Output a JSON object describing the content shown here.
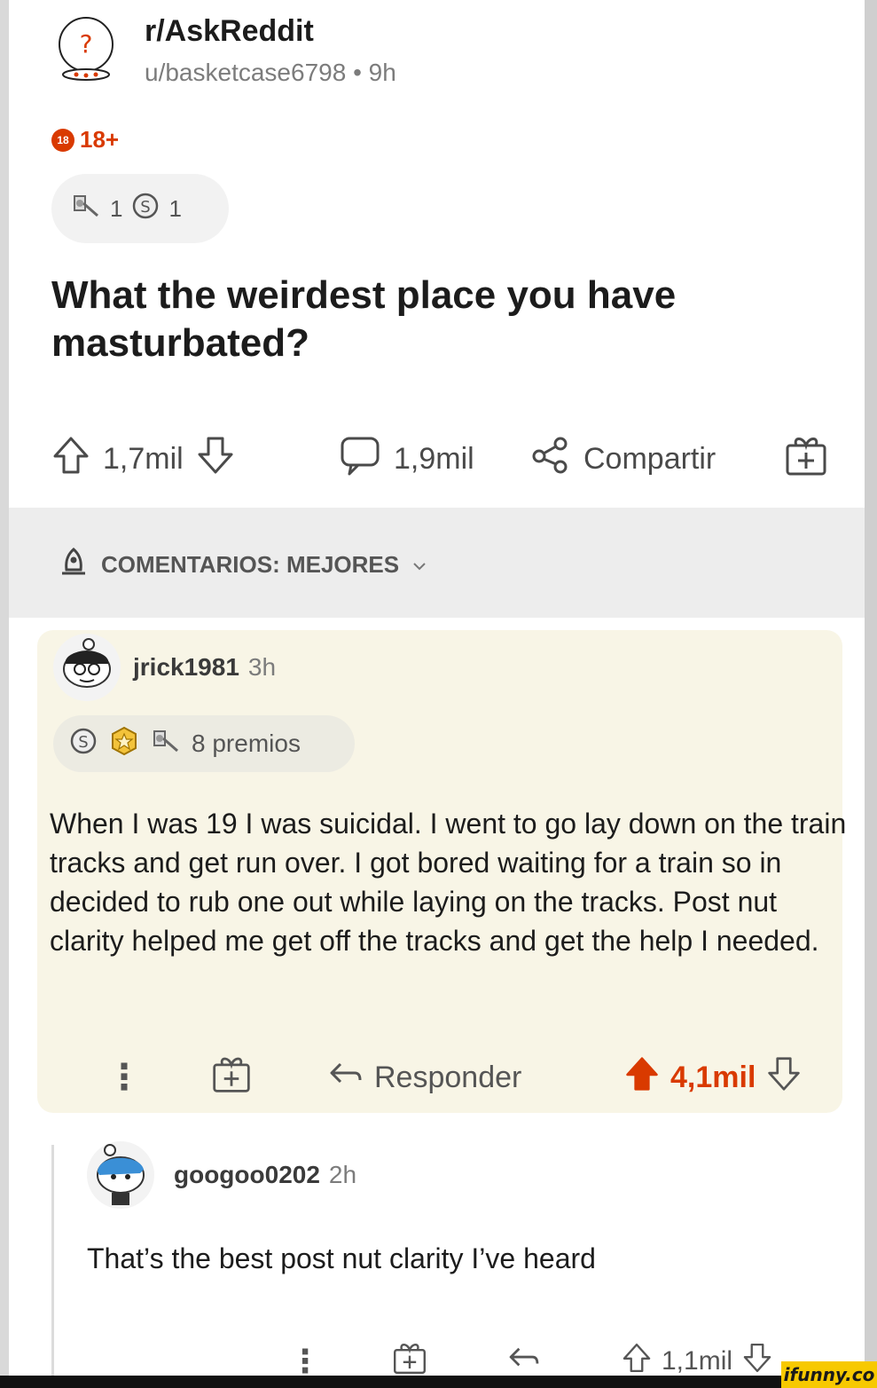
{
  "header": {
    "subreddit": "r/AskReddit",
    "author": "u/basketcase6798",
    "age": "9h",
    "separator": "•",
    "nsfw_badge": "18+",
    "nsfw_dot": "18",
    "awards": [
      {
        "icon": "award-icon",
        "count": "1"
      },
      {
        "icon": "silver-coin-icon",
        "count": "1"
      }
    ]
  },
  "post": {
    "title": "What the weirdest place you have masturbated?",
    "upvotes": "1,7mil",
    "comments": "1,9mil",
    "share_label": "Compartir"
  },
  "sort": {
    "label": "COMENTARIOS: MEJORES"
  },
  "comments": [
    {
      "username": "jrick1981",
      "age": "3h",
      "awards_label": "8 premios",
      "body": "When I was 19 I was suicidal. I went to go lay down on the train tracks and get run over. I got bored waiting for a train so in decided to rub one out while laying on the tracks. Post nut clarity helped me get off the tracks and get the help I needed.",
      "reply_label": "Responder",
      "score": "4,1mil",
      "upvoted": true
    },
    {
      "username": "googoo0202",
      "age": "2h",
      "body": "That’s the best post nut clarity I’ve heard",
      "score": "1,1mil",
      "upvoted": false
    }
  ],
  "more_icon": "⋮",
  "watermark": "ifunny.co",
  "colors": {
    "accent": "#d93a00",
    "comment_highlight": "#f8f5e6",
    "sort_bar": "#ededed",
    "watermark_bg": "#f7c900"
  }
}
